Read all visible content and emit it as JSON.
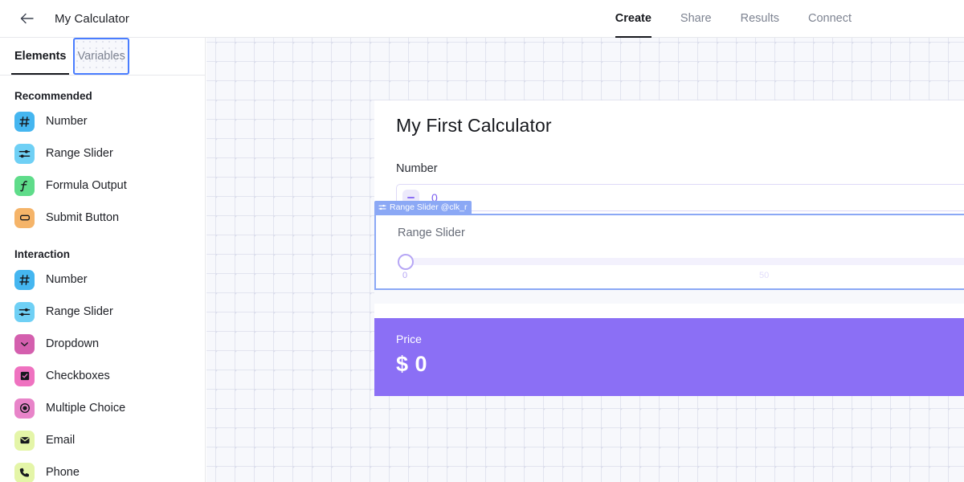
{
  "header": {
    "back_icon": "arrow-left-icon",
    "title": "My Calculator",
    "nav": [
      {
        "label": "Create",
        "active": true
      },
      {
        "label": "Share",
        "active": false
      },
      {
        "label": "Results",
        "active": false
      },
      {
        "label": "Connect",
        "active": false
      }
    ]
  },
  "sidebar": {
    "tabs": [
      {
        "label": "Elements",
        "active": true,
        "focused": false
      },
      {
        "label": "Variables",
        "active": false,
        "focused": true
      }
    ],
    "sections": [
      {
        "title": "Recommended",
        "items": [
          {
            "label": "Number",
            "icon": "hash-icon",
            "color": "#45b6f0"
          },
          {
            "label": "Range Slider",
            "icon": "sliders-icon",
            "color": "#6fd0f5"
          },
          {
            "label": "Formula Output",
            "icon": "function-icon",
            "color": "#5fdc8a"
          },
          {
            "label": "Submit Button",
            "icon": "button-icon",
            "color": "#f5b469"
          }
        ]
      },
      {
        "title": "Interaction",
        "items": [
          {
            "label": "Number",
            "icon": "hash-icon",
            "color": "#45b6f0"
          },
          {
            "label": "Range Slider",
            "icon": "sliders-icon",
            "color": "#6fd0f5"
          },
          {
            "label": "Dropdown",
            "icon": "chevron-down-icon",
            "color": "#d45fae"
          },
          {
            "label": "Checkboxes",
            "icon": "checkbox-icon",
            "color": "#ef72c0"
          },
          {
            "label": "Multiple Choice",
            "icon": "radio-icon",
            "color": "#e884c9"
          },
          {
            "label": "Email",
            "icon": "envelope-icon",
            "color": "#e4f5a8"
          },
          {
            "label": "Phone",
            "icon": "phone-icon",
            "color": "#e4f5a8"
          }
        ]
      }
    ]
  },
  "canvas": {
    "form": {
      "title": "My First Calculator",
      "number_field": {
        "label": "Number",
        "value": "0",
        "stepper_icon": "minus-icon"
      },
      "selected_block": {
        "badge_icon": "sliders-icon",
        "badge_label": "Range Slider @clk_r",
        "label": "Range Slider",
        "min_label": "0",
        "mid_label": "50"
      },
      "price_block": {
        "label": "Price",
        "value": "$ 0",
        "color": "#8b6ff5"
      }
    }
  }
}
